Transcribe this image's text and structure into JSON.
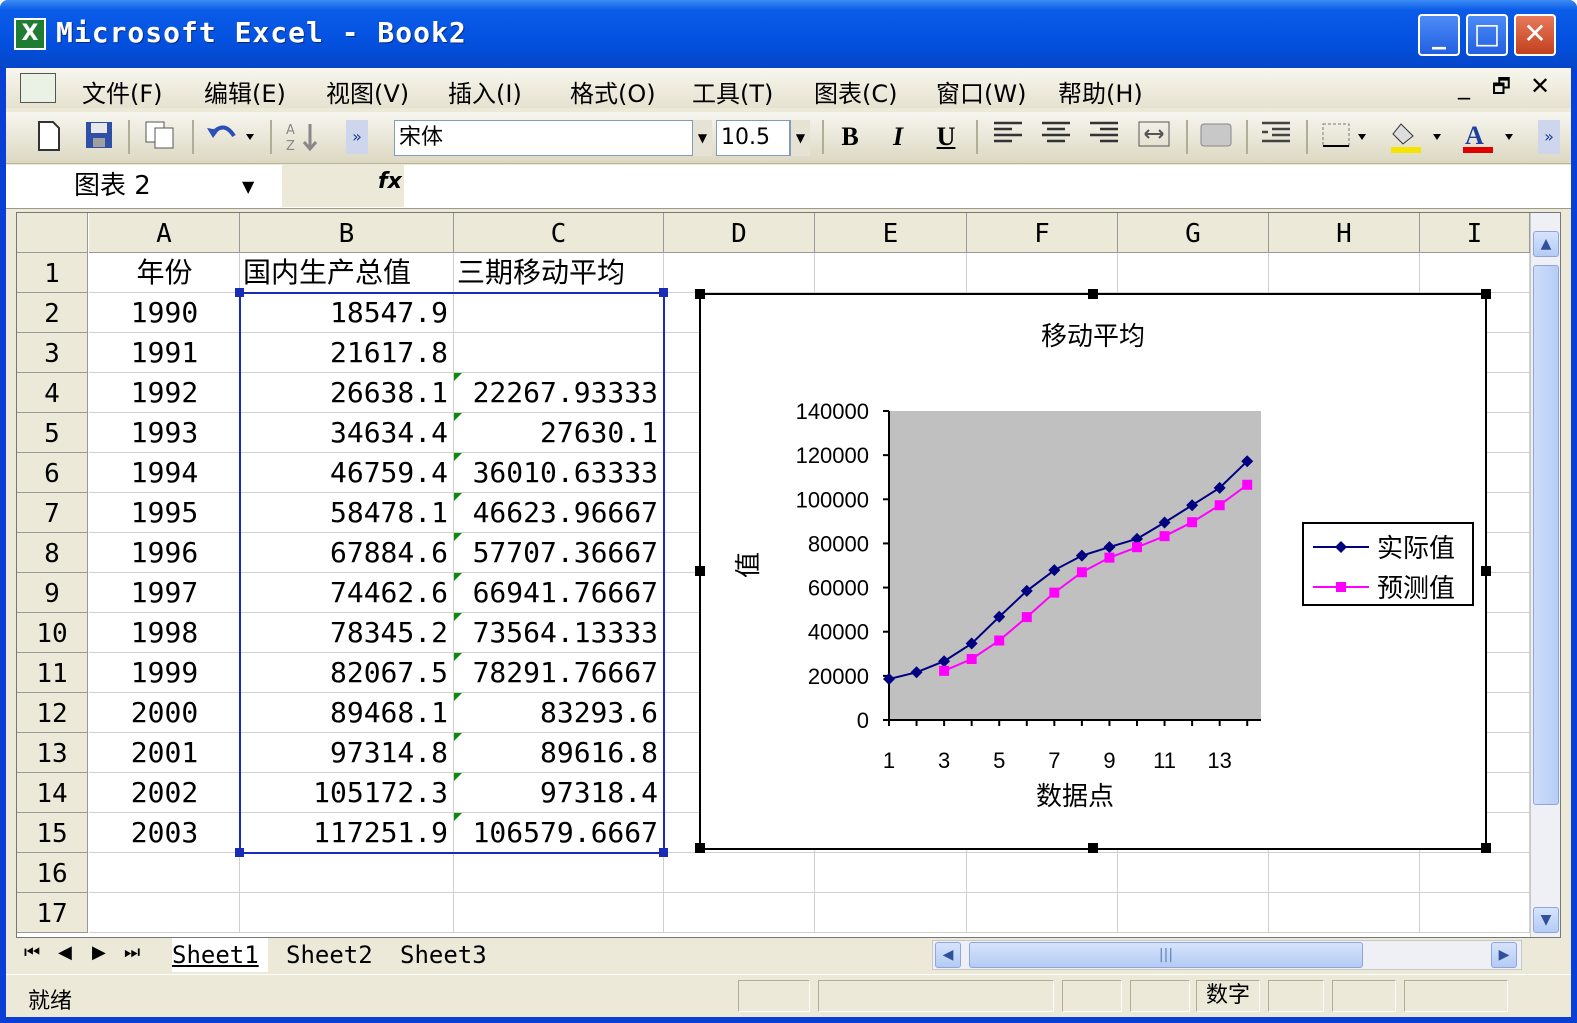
{
  "window": {
    "title": "Microsoft Excel - Book2",
    "app_icon": "X",
    "minimize": "_",
    "maximize": "□",
    "close": "✕"
  },
  "menu": {
    "items": [
      "文件(F)",
      "编辑(E)",
      "视图(V)",
      "插入(I)",
      "格式(O)",
      "工具(T)",
      "图表(C)",
      "窗口(W)",
      "帮助(H)"
    ],
    "mdi_min": "_",
    "mdi_restore": "🗗",
    "mdi_close": "✕"
  },
  "toolbar": {
    "font_name": "宋体",
    "font_size": "10.5",
    "bold": "B",
    "italic": "I",
    "underline": "U",
    "icons": [
      "new-icon",
      "save-icon",
      "copy-icon",
      "undo-icon",
      "sort-icon",
      "bold-icon",
      "italic-icon",
      "underline-icon",
      "align-left-icon",
      "align-center-icon",
      "align-right-icon",
      "merge-center-icon",
      "borders-icon",
      "fill-color-icon",
      "font-color-icon"
    ],
    "fill_color": "#f5e400",
    "font_color": "#e00000"
  },
  "formula_bar": {
    "name_box": "图表 2",
    "fx": "fx",
    "formula": ""
  },
  "sheet": {
    "columns": [
      "A",
      "B",
      "C",
      "D",
      "E",
      "F",
      "G",
      "H",
      "I"
    ],
    "rows": [
      "1",
      "2",
      "3",
      "4",
      "5",
      "6",
      "7",
      "8",
      "9",
      "10",
      "11",
      "12",
      "13",
      "14",
      "15",
      "16",
      "17"
    ],
    "header_row": [
      "年份",
      "国内生产总值",
      "三期移动平均"
    ],
    "data": [
      [
        "1990",
        "18547.9",
        ""
      ],
      [
        "1991",
        "21617.8",
        ""
      ],
      [
        "1992",
        "26638.1",
        "22267.93333"
      ],
      [
        "1993",
        "34634.4",
        "27630.1"
      ],
      [
        "1994",
        "46759.4",
        "36010.63333"
      ],
      [
        "1995",
        "58478.1",
        "46623.96667"
      ],
      [
        "1996",
        "67884.6",
        "57707.36667"
      ],
      [
        "1997",
        "74462.6",
        "66941.76667"
      ],
      [
        "1998",
        "78345.2",
        "73564.13333"
      ],
      [
        "1999",
        "82067.5",
        "78291.76667"
      ],
      [
        "2000",
        "89468.1",
        "83293.6"
      ],
      [
        "2001",
        "97314.8",
        "89616.8"
      ],
      [
        "2002",
        "105172.3",
        "97318.4"
      ],
      [
        "2003",
        "117251.9",
        "106579.6667"
      ]
    ],
    "selection_color": "#1a2cb5",
    "error_indicator_color": "#0a8a0a"
  },
  "chart_data": {
    "type": "line",
    "title": "移动平均",
    "xlabel": "数据点",
    "ylabel": "值",
    "x": [
      1,
      2,
      3,
      4,
      5,
      6,
      7,
      8,
      9,
      10,
      11,
      12,
      13,
      14
    ],
    "x_tick_labels": [
      "1",
      "3",
      "5",
      "7",
      "9",
      "11",
      "13"
    ],
    "y_tick_labels": [
      "0",
      "20000",
      "40000",
      "60000",
      "80000",
      "100000",
      "120000",
      "140000"
    ],
    "ylim": [
      0,
      140000
    ],
    "plot_area_color": "#c0c0c0",
    "legend_position": "right",
    "series": [
      {
        "name": "实际值",
        "color": "#000080",
        "marker": "diamond",
        "values": [
          18547.9,
          21617.8,
          26638.1,
          34634.4,
          46759.4,
          58478.1,
          67884.6,
          74462.6,
          78345.2,
          82067.5,
          89468.1,
          97314.8,
          105172.3,
          117251.9
        ]
      },
      {
        "name": "预测值",
        "color": "#ff00ff",
        "marker": "square",
        "values": [
          null,
          null,
          22267.93333,
          27630.1,
          36010.63333,
          46623.96667,
          57707.36667,
          66941.76667,
          73564.13333,
          78291.76667,
          83293.6,
          89616.8,
          97318.4,
          106579.6667
        ]
      }
    ]
  },
  "tabs": {
    "nav": [
      "⏮",
      "◀",
      "▶",
      "⏭"
    ],
    "sheets": [
      "Sheet1",
      "Sheet2",
      "Sheet3"
    ],
    "active": "Sheet1"
  },
  "status": {
    "ready": "就绪",
    "num": "数字"
  }
}
